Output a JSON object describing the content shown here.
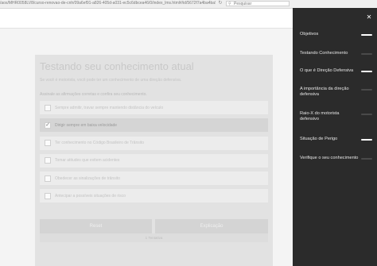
{
  "browser": {
    "url": "/aos/MHR0058LV8/curso-renovao-de-cnh/09a6ef91-a826-405d-a031-ec5c6dbcea46/0/index_lms.html#/id/5672f7a4ba4ba957073306d47",
    "reload_icon": "reload-icon",
    "search_placeholder": "Pesquisar",
    "search_icon": "search-icon"
  },
  "quiz": {
    "title": "Testando seu conhecimento atual",
    "subtitle": "Se você é motorista, você pode ter um conhecimento de uma direção defensiva.",
    "instruction": "Assinale as afirmações corretas e confira seu conhecimento.",
    "options": [
      {
        "label": "Sempre admitir, travar sempre mantendo distância do veículo",
        "checked": false
      },
      {
        "label": "Dirigir sempre em baixa velocidade",
        "checked": true
      },
      {
        "label": "Ter conhecimento no Código Brasileiro de Trânsito",
        "checked": false
      },
      {
        "label": "Tomar atitudes que evitem acidentes",
        "checked": false
      },
      {
        "label": "Obedecer as sinalizações de trânsito",
        "checked": false
      },
      {
        "label": "Antecipar a possíveis situações de risco",
        "checked": false
      }
    ],
    "reset_label": "Reset",
    "explain_label": "Explicação",
    "attempts_text": "1 Tentativa"
  },
  "sidebar": {
    "close_icon": "close-icon",
    "items": [
      {
        "label": "Objetivos",
        "active": true
      },
      {
        "label": "Testando Conhecimento",
        "active": false
      },
      {
        "label": "O que é Direção Defensiva",
        "active": true
      },
      {
        "label": "A importância da direção defensiva",
        "active": false
      },
      {
        "label": "Raio-X do motorista defensivo",
        "active": false
      },
      {
        "label": "Situação de Perigo",
        "active": true
      },
      {
        "label": "Verifique o seu conhecimento",
        "active": false
      }
    ]
  },
  "colors": {
    "sidebar_bg": "#2b2b2b",
    "progress_on": "#ffffff",
    "progress_off": "#4a4a4a"
  }
}
